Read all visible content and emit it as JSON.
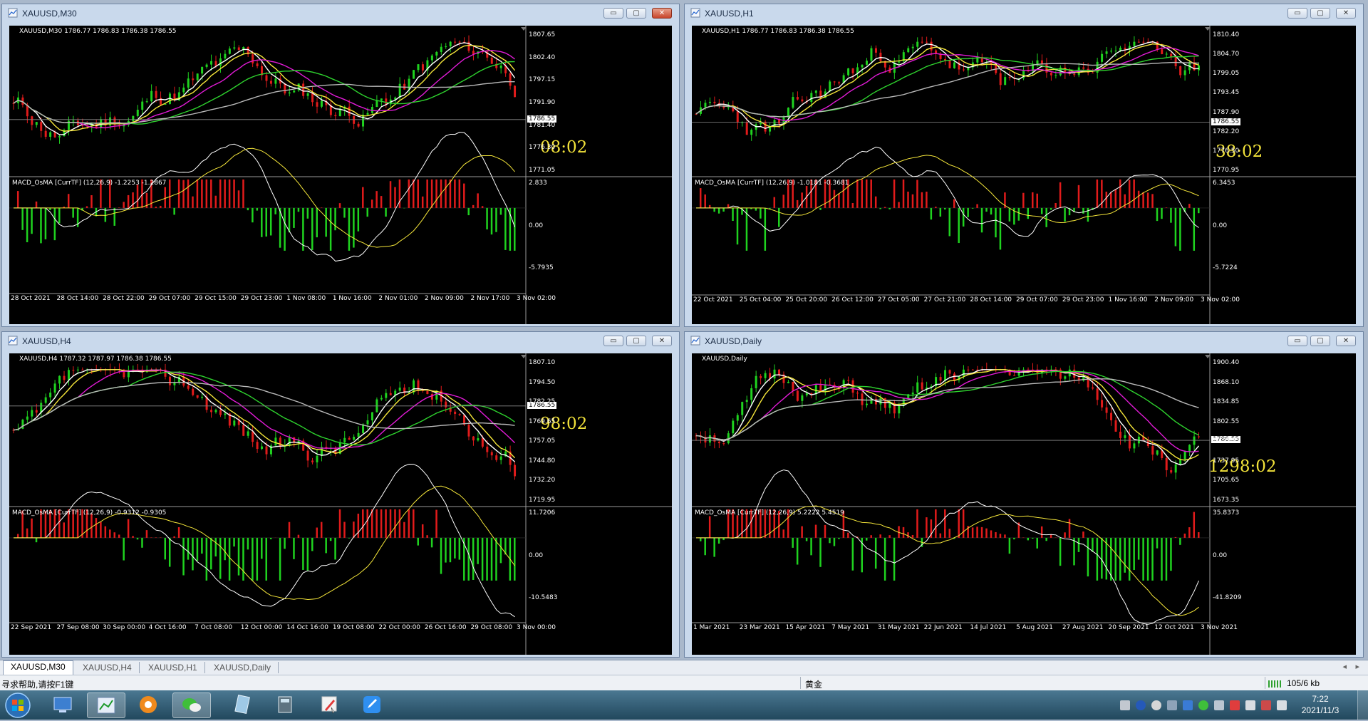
{
  "windows": {
    "m30": {
      "title": "XAUUSD,M30",
      "symbol_info": "XAUUSD,M30  1786.77 1786.83 1786.38 1786.55",
      "price_ticks": [
        "1807.65",
        "1802.40",
        "1797.15",
        "1791.90",
        "1781.40",
        "1776.30",
        "1771.05"
      ],
      "current_price": "1786.55",
      "timer": "08:02",
      "macd_info": "MACD_OsMA [CurrTF] (12,26,9) -1.2253 -1.2867",
      "macd_ticks": [
        "2.833",
        "0.00",
        "-5.7935"
      ],
      "time_ticks": [
        "28 Oct 2021",
        "28 Oct 14:00",
        "28 Oct 22:00",
        "29 Oct 07:00",
        "29 Oct 15:00",
        "29 Oct 23:00",
        "1 Nov 08:00",
        "1 Nov 16:00",
        "2 Nov 01:00",
        "2 Nov 09:00",
        "2 Nov 17:00",
        "3 Nov 02:00"
      ]
    },
    "h1": {
      "title": "XAUUSD,H1",
      "symbol_info": "XAUUSD,H1  1786.77 1786.83 1786.38 1786.55",
      "price_ticks": [
        "1810.40",
        "1804.70",
        "1799.05",
        "1793.45",
        "1787.90",
        "1782.20",
        "1776.50",
        "1770.95"
      ],
      "current_price": "1786.55",
      "timer": "38:02",
      "macd_info": "MACD_OsMA [CurrTF] (12,26,9) -1.0181 -0.3681",
      "macd_ticks": [
        "6.3453",
        "0.00",
        "-5.7224"
      ],
      "time_ticks": [
        "22 Oct 2021",
        "25 Oct 04:00",
        "25 Oct 20:00",
        "26 Oct 12:00",
        "27 Oct 05:00",
        "27 Oct 21:00",
        "28 Oct 14:00",
        "29 Oct 07:00",
        "29 Oct 23:00",
        "1 Nov 16:00",
        "2 Nov 09:00",
        "3 Nov 02:00"
      ]
    },
    "h4": {
      "title": "XAUUSD,H4",
      "symbol_info": "XAUUSD,H4  1787.32 1787.97 1786.38 1786.55",
      "price_ticks": [
        "1807.10",
        "1794.50",
        "1782.25",
        "1769.65",
        "1757.05",
        "1744.80",
        "1732.20",
        "1719.95"
      ],
      "current_price": "1786.55",
      "timer": "98:02",
      "macd_info": "MACD_OsMA [CurrTF] (12,26,9) -0.9312 -0.9305",
      "macd_ticks": [
        "11.7206",
        "0.00",
        "-10.5483"
      ],
      "time_ticks": [
        "22 Sep 2021",
        "27 Sep 08:00",
        "30 Sep 00:00",
        "4 Oct 16:00",
        "7 Oct 08:00",
        "12 Oct 00:00",
        "14 Oct 16:00",
        "19 Oct 08:00",
        "22 Oct 00:00",
        "26 Oct 16:00",
        "29 Oct 08:00",
        "3 Nov 00:00"
      ]
    },
    "daily": {
      "title": "XAUUSD,Daily",
      "symbol_info": "XAUUSD,Daily",
      "price_ticks": [
        "1900.40",
        "1868.10",
        "1834.85",
        "1802.55",
        "1770.25",
        "1737.95",
        "1705.65",
        "1673.35"
      ],
      "current_price": "1786.55",
      "timer": "1298:02",
      "macd_info": "MACD_OsMA [CurrTF] (12,26,9) 5.2222 5.4519",
      "macd_ticks": [
        "35.8373",
        "0.00",
        "-41.8209"
      ],
      "time_ticks": [
        "1 Mar 2021",
        "23 Mar 2021",
        "15 Apr 2021",
        "7 May 2021",
        "31 May 2021",
        "22 Jun 2021",
        "14 Jul 2021",
        "5 Aug 2021",
        "27 Aug 2021",
        "20 Sep 2021",
        "12 Oct 2021",
        "3 Nov 2021"
      ]
    }
  },
  "window_buttons": {
    "minimize": "▭",
    "restore": "▢",
    "close": "✕"
  },
  "tabs": [
    "XAUUSD,M30",
    "XAUUSD,H4",
    "XAUUSD,H1",
    "XAUUSD,Daily"
  ],
  "tab_arrows": {
    "left": "◂",
    "right": "▸"
  },
  "status": {
    "help": "寻求帮助,请按F1键",
    "profile": "黄金",
    "traffic": "105/6 kb"
  },
  "taskbar": {
    "time": "7:22",
    "date": "2021/11/3"
  },
  "colors": {
    "bull": "#1fd21f",
    "bear": "#e11b1b",
    "ma_white": "#ffffff",
    "ma_yellow": "#f5e63a",
    "ma_magenta": "#e11bd6",
    "ma_green": "#2ed22e",
    "ma_gray": "#b9b9b9",
    "timer": "#f2e23a"
  }
}
